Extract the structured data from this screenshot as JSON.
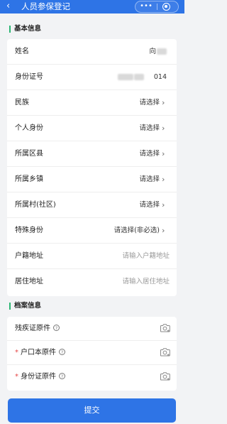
{
  "header": {
    "back_icon": "‹",
    "title": "人员参保登记",
    "more_icon": "•••",
    "close_icon": "target-icon"
  },
  "sections": {
    "basic": "基本信息",
    "archive": "档案信息"
  },
  "fields": {
    "name": {
      "label": "姓名",
      "value": "向"
    },
    "id_number": {
      "label": "身份证号",
      "value": "014"
    },
    "ethnicity": {
      "label": "民族",
      "value": "请选择"
    },
    "identity": {
      "label": "个人身份",
      "value": "请选择"
    },
    "county": {
      "label": "所属区县",
      "value": "请选择"
    },
    "town": {
      "label": "所属乡镇",
      "value": "请选择"
    },
    "village": {
      "label": "所属村(社区)",
      "value": "请选择"
    },
    "special": {
      "label": "特殊身份",
      "value": "请选择(非必选)"
    },
    "household_addr": {
      "label": "户籍地址",
      "placeholder": "请输入户籍地址"
    },
    "residence_addr": {
      "label": "居住地址",
      "placeholder": "请输入居住地址"
    }
  },
  "files": {
    "disability": {
      "label": "残疾证原件",
      "required": false
    },
    "household": {
      "label": "户口本原件",
      "required": true
    },
    "idcard": {
      "label": "身份证原件",
      "required": true
    },
    "required_mark": "*",
    "help_mark": "?"
  },
  "chevron": "›",
  "submit_label": "提交",
  "colors": {
    "brand": "#2e74e6",
    "accent_bar": "#2bb673",
    "required": "#e54545"
  }
}
